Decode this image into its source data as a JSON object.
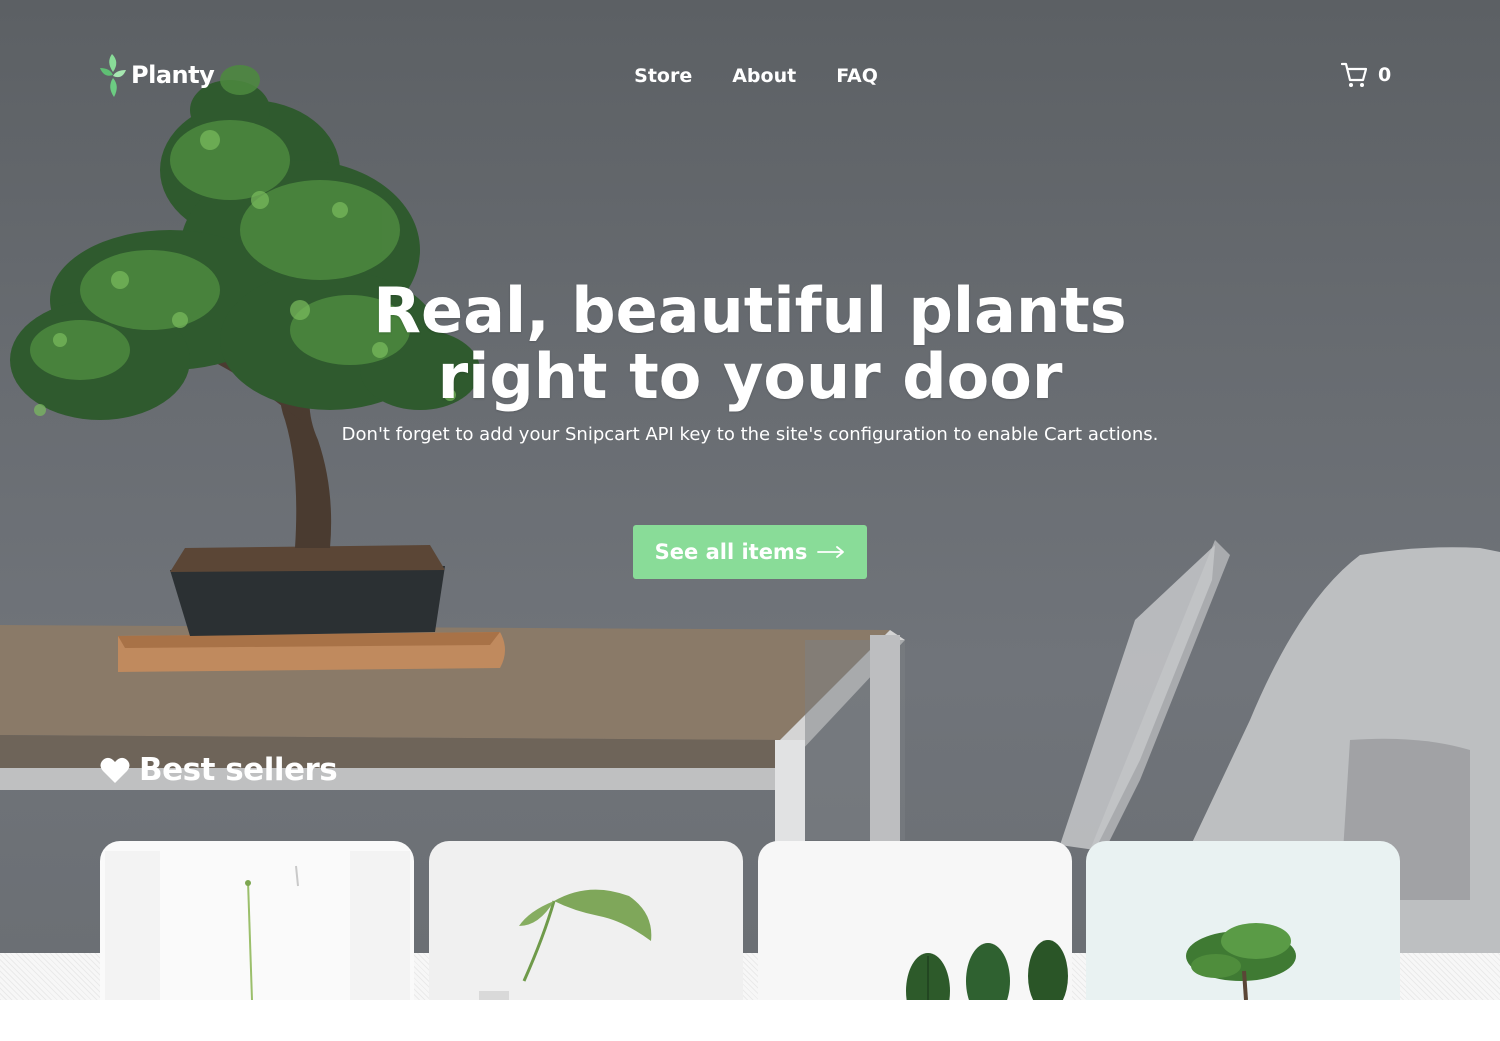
{
  "brand": {
    "name": "Planty"
  },
  "nav": {
    "items": [
      "Store",
      "About",
      "FAQ"
    ]
  },
  "cart": {
    "count": "0",
    "icon": "cart-icon"
  },
  "hero": {
    "headline_line1": "Real, beautiful plants",
    "headline_line2": "right to your door",
    "subtitle": "Don't forget to add your Snipcart API key to the site's configuration to enable Cart actions.",
    "cta_label": "See all items",
    "cta_icon": "arrow-right-icon"
  },
  "best_sellers": {
    "title": "Best sellers",
    "icon": "heart-icon"
  },
  "products": [
    {
      "image": "grass-plant-image"
    },
    {
      "image": "monstera-leaf-image"
    },
    {
      "image": "zz-plant-image"
    },
    {
      "image": "bonsai-plant-image"
    }
  ],
  "colors": {
    "accent": "#89dc98",
    "text_light": "#ffffff"
  }
}
